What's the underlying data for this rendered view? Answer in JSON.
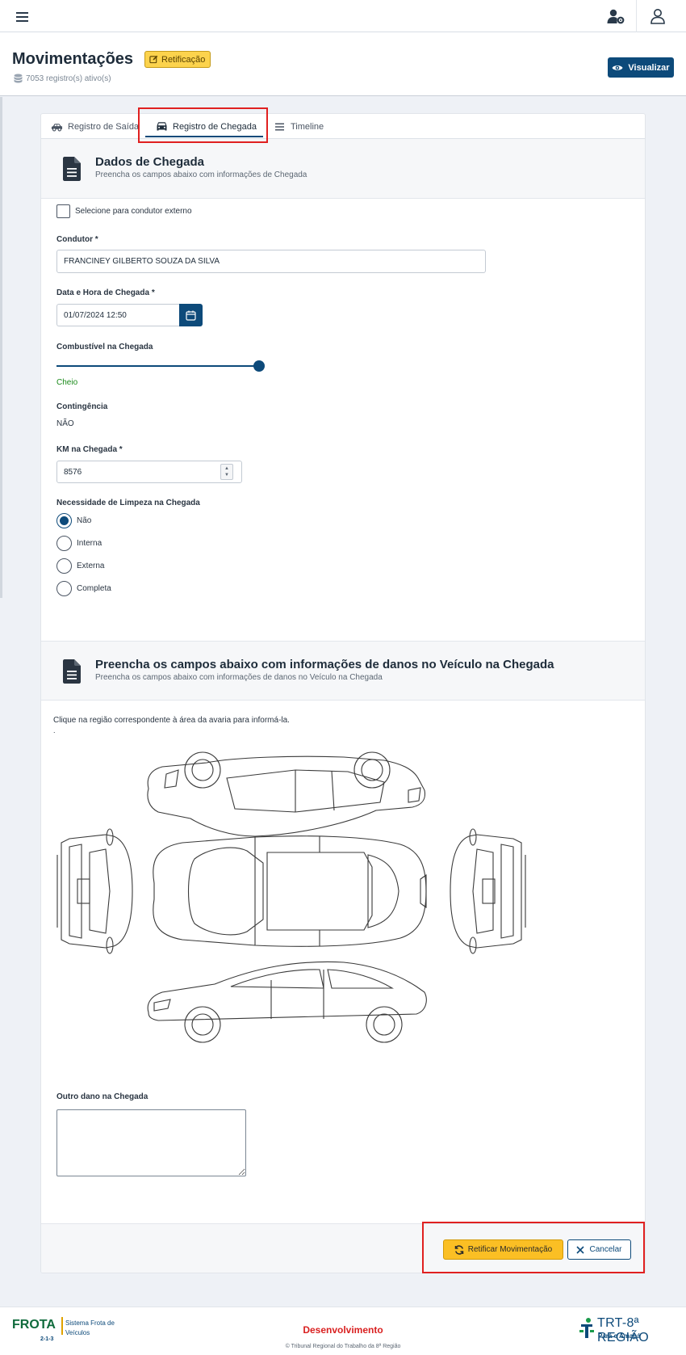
{
  "topbar": {
    "menu_icon": "hamburger-icon",
    "user_settings_icon": "user-gear-icon",
    "user_icon": "user-icon"
  },
  "header": {
    "title": "Movimentações",
    "badge": "Retificação",
    "records": "7053 registro(s) ativo(s)",
    "view_button": "Visualizar"
  },
  "tabs": [
    {
      "label": "Registro de Saída",
      "icon": "car-side-icon",
      "active": false
    },
    {
      "label": "Registro de Chegada",
      "icon": "car-front-icon",
      "active": true
    },
    {
      "label": "Timeline",
      "icon": "list-icon",
      "active": false
    }
  ],
  "arrival_section": {
    "title": "Dados de Chegada",
    "subtitle": "Preencha os campos abaixo com informações de Chegada",
    "external_driver_label": "Selecione para condutor externo",
    "external_driver_checked": false,
    "driver_label": "Condutor *",
    "driver_value": "FRANCINEY GILBERTO SOUZA DA SILVA",
    "datetime_label": "Data e Hora de Chegada *",
    "datetime_value": "01/07/2024 12:50",
    "fuel_label": "Combustível na Chegada",
    "fuel_level_percent": 100,
    "fuel_value": "Cheio",
    "contingency_label": "Contingência",
    "contingency_value": "NÃO",
    "km_label": "KM na Chegada *",
    "km_value": "8576",
    "cleaning_label": "Necessidade de Limpeza na Chegada",
    "cleaning_options": [
      "Não",
      "Interna",
      "Externa",
      "Completa"
    ],
    "cleaning_selected": "Não"
  },
  "damage_section": {
    "title": "Preencha os campos abaixo com informações de danos no Veículo na Chegada",
    "subtitle": "Preencha os campos abaixo com informações de danos no Veículo na Chegada",
    "instruction": "Clique na região correspondente à área da avaria para informá-la.",
    "dot": ".",
    "other_damage_label": "Outro dano na Chegada",
    "other_damage_value": ""
  },
  "actions": {
    "rectify_button": "Retificar Movimentação",
    "cancel_button": "Cancelar"
  },
  "footer": {
    "brand": "FROTA",
    "brand_version": "2-1-3",
    "brand_desc": "Sistema Frota de Veículos",
    "environment": "Desenvolvimento",
    "copyright": "© Tribunal Regional do Trabalho da 8ª Região",
    "org_name": "TRT-8ª REGIÃO",
    "org_sub": "Pará e Amapá"
  },
  "colors": {
    "primary": "#0d4a7a",
    "warning": "#fbbf24",
    "highlight": "#e02020",
    "env": "#d92020"
  }
}
